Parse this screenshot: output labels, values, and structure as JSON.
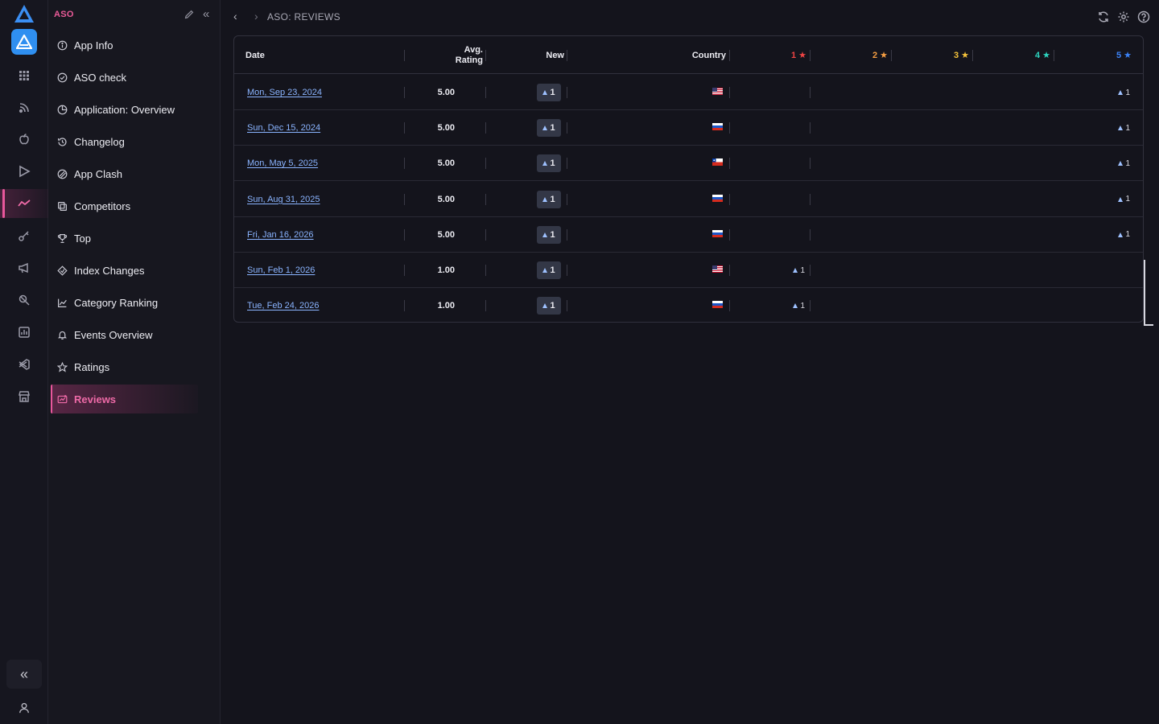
{
  "app": {
    "section_title": "ASO"
  },
  "rail": {
    "icons": [
      "logo-icon",
      "app-icon",
      "grid-icon",
      "rss-icon",
      "apple-icon",
      "play-icon",
      "trend-icon",
      "key-icon",
      "megaphone-icon",
      "search-tools-icon",
      "report-icon",
      "vscode-icon",
      "store-icon"
    ],
    "active": "trend-icon"
  },
  "sidebar": {
    "items": [
      {
        "label": "App Info",
        "icon": "info-icon"
      },
      {
        "label": "ASO check",
        "icon": "check-circle-icon"
      },
      {
        "label": "Application: Overview",
        "icon": "pie-icon"
      },
      {
        "label": "Changelog",
        "icon": "history-icon"
      },
      {
        "label": "App Clash",
        "icon": "clash-icon"
      },
      {
        "label": "Competitors",
        "icon": "competitors-icon"
      },
      {
        "label": "Top",
        "icon": "trophy-icon"
      },
      {
        "label": "Index Changes",
        "icon": "index-icon"
      },
      {
        "label": "Category Ranking",
        "icon": "chart-line-icon"
      },
      {
        "label": "Events Overview",
        "icon": "bell-icon"
      },
      {
        "label": "Ratings",
        "icon": "star-icon"
      },
      {
        "label": "Reviews",
        "icon": "reviews-icon",
        "active": true
      }
    ]
  },
  "breadcrumb": {
    "text": "ASO: REVIEWS"
  },
  "table": {
    "headers": {
      "date": "Date",
      "avg_rating_1": "Avg.",
      "avg_rating_2": "Rating",
      "new": "New",
      "country": "Country",
      "s1": "1",
      "s2": "2",
      "s3": "3",
      "s4": "4",
      "s5": "5"
    },
    "star_colors": {
      "s1": "#ef4444",
      "s2": "#f59e42",
      "s3": "#f5c33b",
      "s4": "#2dd4bf",
      "s5": "#3b82f6"
    },
    "rows": [
      {
        "date": "Mon, Sep 23, 2024",
        "rating": "5.00",
        "new": "1",
        "country": "US",
        "star": 5,
        "count": "1"
      },
      {
        "date": "Sun, Dec 15, 2024",
        "rating": "5.00",
        "new": "1",
        "country": "RU",
        "star": 5,
        "count": "1"
      },
      {
        "date": "Mon, May 5, 2025",
        "rating": "5.00",
        "new": "1",
        "country": "CL",
        "star": 5,
        "count": "1"
      },
      {
        "date": "Sun, Aug 31, 2025",
        "rating": "5.00",
        "new": "1",
        "country": "RU",
        "star": 5,
        "count": "1"
      },
      {
        "date": "Fri, Jan 16, 2026",
        "rating": "5.00",
        "new": "1",
        "country": "RU",
        "star": 5,
        "count": "1"
      },
      {
        "date": "Sun, Feb 1, 2026",
        "rating": "1.00",
        "new": "1",
        "country": "US",
        "star": 1,
        "count": "1"
      },
      {
        "date": "Tue, Feb 24, 2026",
        "rating": "1.00",
        "new": "1",
        "country": "RU",
        "star": 1,
        "count": "1"
      }
    ]
  }
}
